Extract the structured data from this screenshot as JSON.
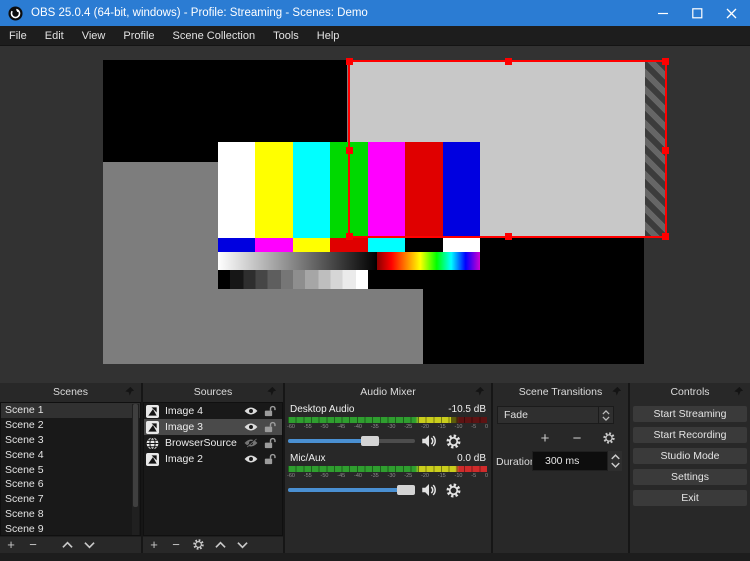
{
  "window": {
    "title": "OBS 25.0.4 (64-bit, windows) - Profile: Streaming - Scenes: Demo"
  },
  "menu": {
    "items": [
      "File",
      "Edit",
      "View",
      "Profile",
      "Scene Collection",
      "Tools",
      "Help"
    ]
  },
  "scenes": {
    "title": "Scenes",
    "items": [
      "Scene 1",
      "Scene 2",
      "Scene 3",
      "Scene 4",
      "Scene 5",
      "Scene 6",
      "Scene 7",
      "Scene 8",
      "Scene 9"
    ],
    "selected": "Scene 1"
  },
  "sources": {
    "title": "Sources",
    "rows": [
      {
        "name": "Image 4",
        "type": "image",
        "visible": true,
        "locked": false
      },
      {
        "name": "Image 3",
        "type": "image",
        "visible": true,
        "locked": false,
        "selected": true
      },
      {
        "name": "BrowserSource",
        "type": "browser",
        "visible": false,
        "locked": false
      },
      {
        "name": "Image 2",
        "type": "image",
        "visible": true,
        "locked": false
      }
    ]
  },
  "mixer": {
    "title": "Audio Mixer",
    "channels": [
      {
        "name": "Desktop Audio",
        "db": "-10.5 dB"
      },
      {
        "name": "Mic/Aux",
        "db": "0.0 dB"
      }
    ],
    "ticks": [
      "-60",
      "-55",
      "-50",
      "-45",
      "-40",
      "-35",
      "-30",
      "-25",
      "-20",
      "-15",
      "-10",
      "-5",
      "0"
    ]
  },
  "transitions": {
    "title": "Scene Transitions",
    "selected": "Fade",
    "duration_label": "Duration",
    "duration_value": "300 ms"
  },
  "controls_panel": {
    "title": "Controls",
    "buttons": [
      "Start Streaming",
      "Start Recording",
      "Studio Mode",
      "Settings",
      "Exit"
    ]
  },
  "colors": {
    "titlebar": "#2b7cd3",
    "selection_red": "#ff0000",
    "slider_blue": "#4a90d2",
    "canvas_gray": "#7d7d7d",
    "selected_source_gray": "#c8c8c8"
  }
}
